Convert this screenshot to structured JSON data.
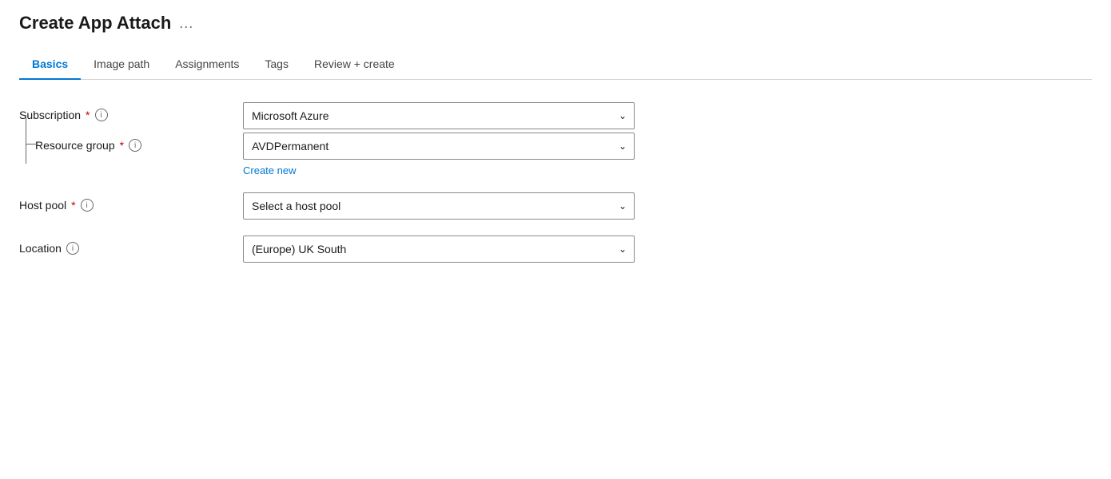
{
  "page": {
    "title": "Create App Attach",
    "more_options_label": "..."
  },
  "tabs": [
    {
      "id": "basics",
      "label": "Basics",
      "active": true
    },
    {
      "id": "image-path",
      "label": "Image path",
      "active": false
    },
    {
      "id": "assignments",
      "label": "Assignments",
      "active": false
    },
    {
      "id": "tags",
      "label": "Tags",
      "active": false
    },
    {
      "id": "review-create",
      "label": "Review + create",
      "active": false
    }
  ],
  "form": {
    "subscription": {
      "label": "Subscription",
      "required": true,
      "value": "Microsoft Azure",
      "options": [
        "Microsoft Azure"
      ]
    },
    "resource_group": {
      "label": "Resource group",
      "required": true,
      "value": "AVDPermanent",
      "options": [
        "AVDPermanent"
      ],
      "create_new_label": "Create new"
    },
    "host_pool": {
      "label": "Host pool",
      "required": true,
      "placeholder": "Select a host pool",
      "value": "",
      "options": []
    },
    "location": {
      "label": "Location",
      "value": "(Europe) UK South",
      "options": [
        "(Europe) UK South"
      ]
    }
  },
  "icons": {
    "info": "i",
    "chevron_down": "⌄",
    "more_options": "···"
  }
}
